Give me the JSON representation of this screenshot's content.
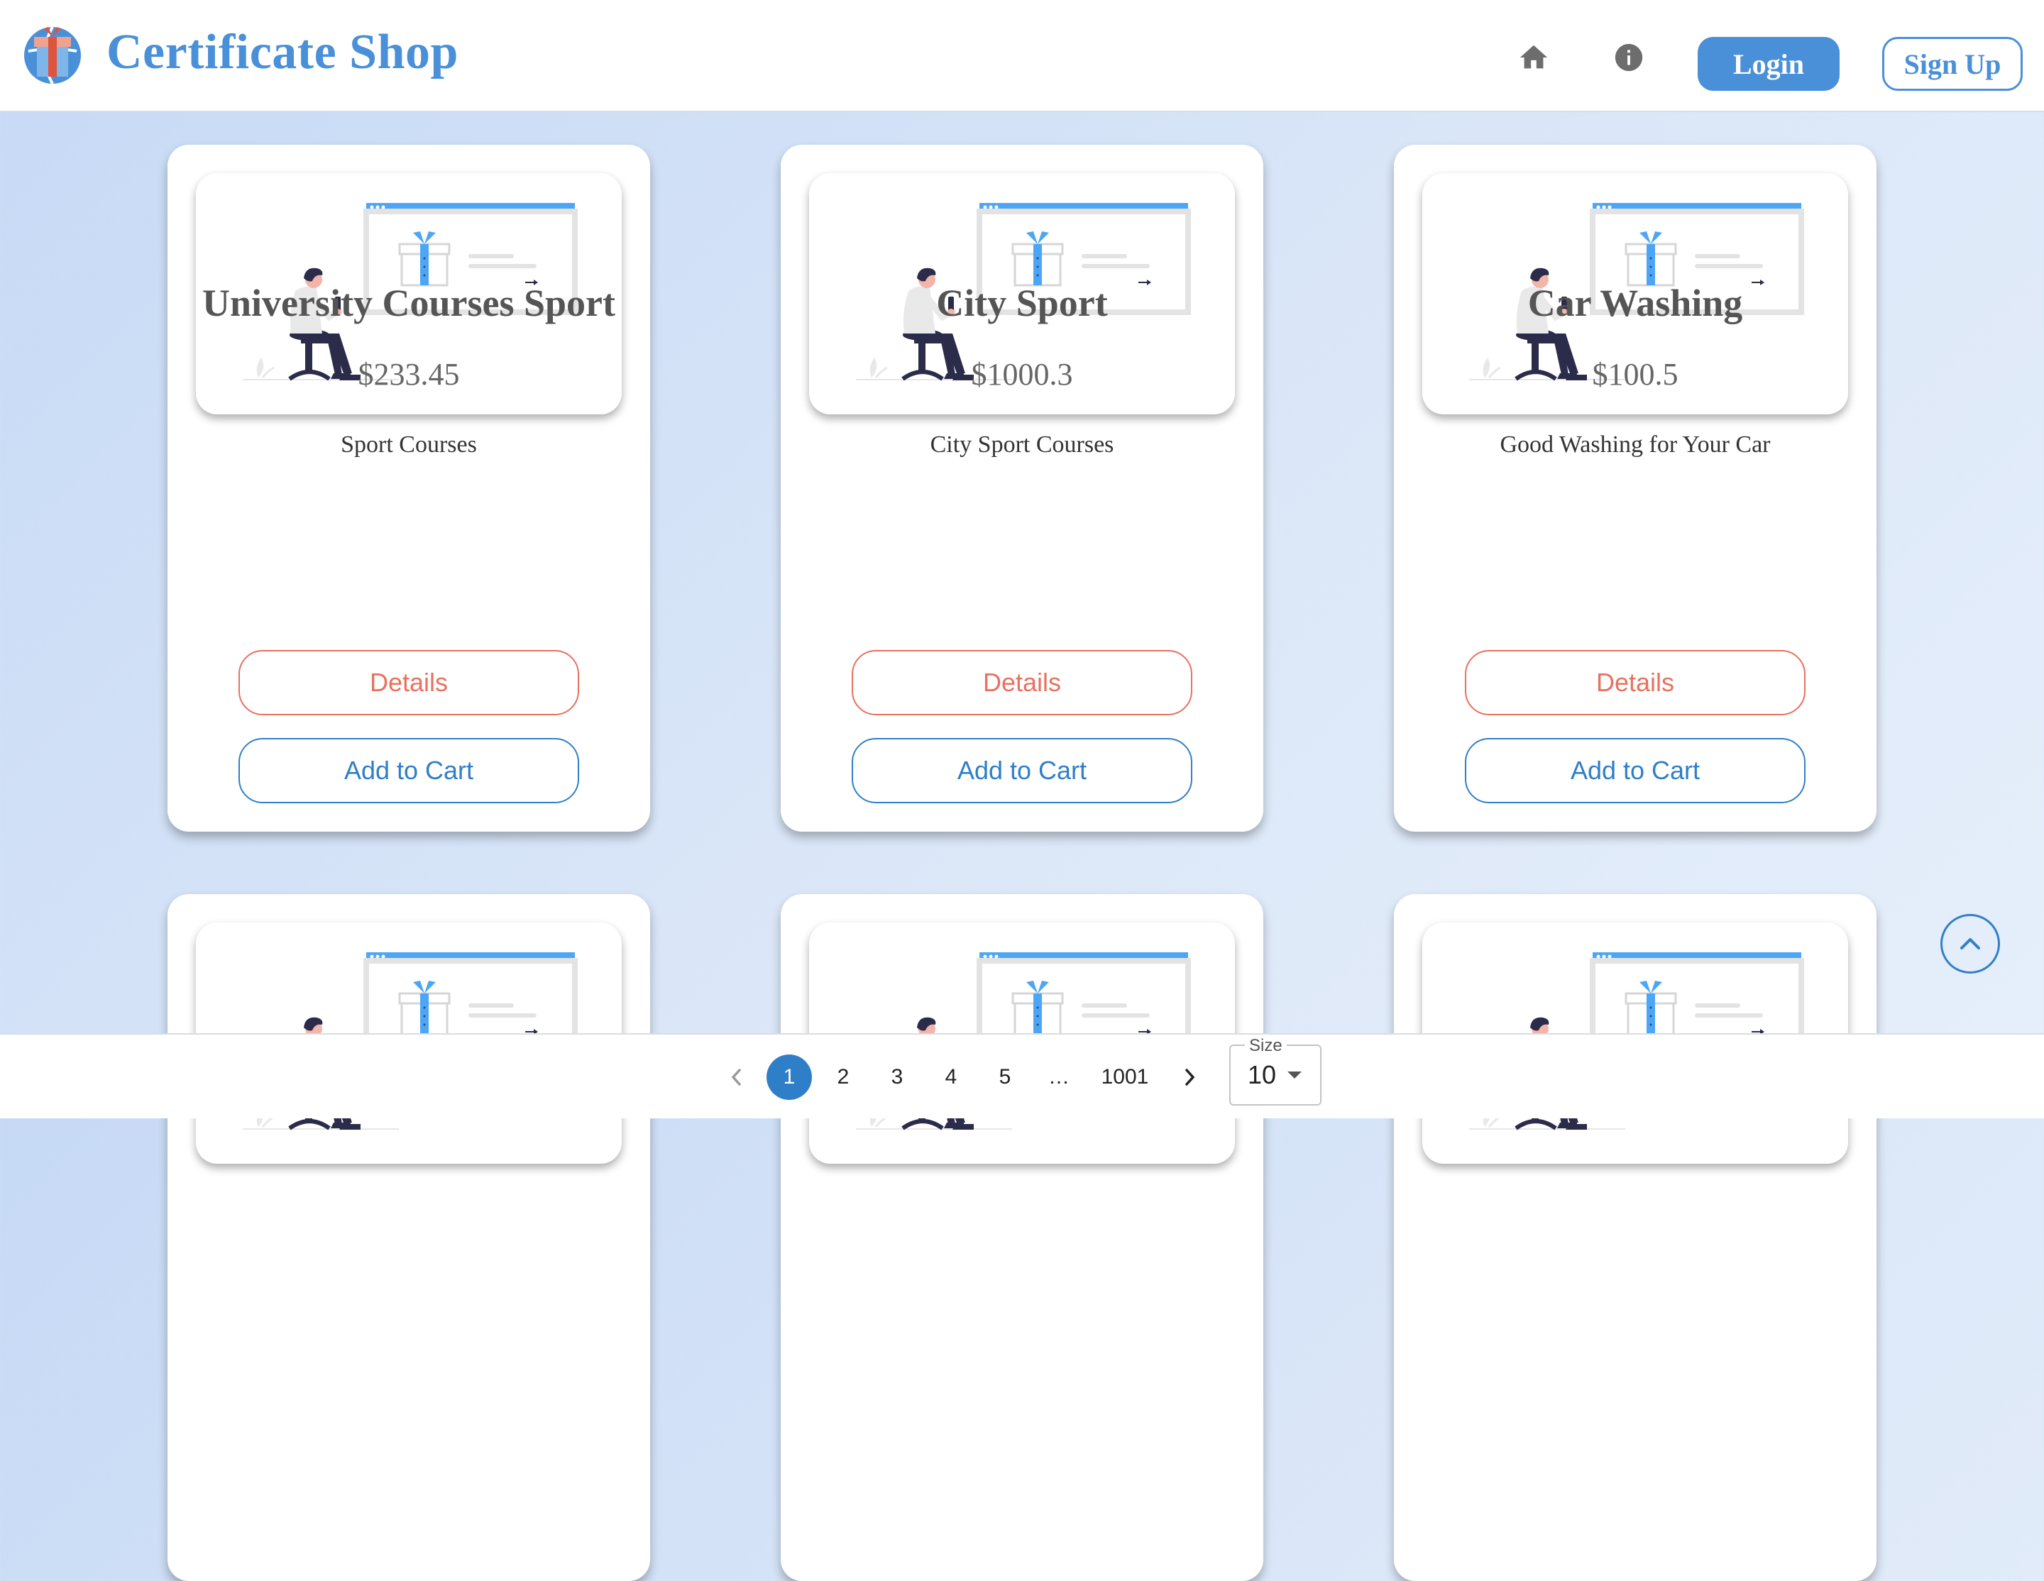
{
  "header": {
    "brand": "Certificate Shop",
    "nav": {
      "home_icon": "home-icon",
      "info_icon": "info-icon"
    },
    "login_label": "Login",
    "signup_label": "Sign Up"
  },
  "cards": [
    {
      "title": "University Courses Sport",
      "price": "$233.45",
      "description": "Sport Courses",
      "details_label": "Details",
      "cart_label": "Add to Cart"
    },
    {
      "title": "City Sport",
      "price": "$1000.3",
      "description": "City Sport Courses",
      "details_label": "Details",
      "cart_label": "Add to Cart"
    },
    {
      "title": "Car Washing",
      "price": "$100.5",
      "description": "Good Washing for Your Car",
      "details_label": "Details",
      "cart_label": "Add to Cart"
    }
  ],
  "pagination": {
    "pages": [
      "1",
      "2",
      "3",
      "4",
      "5",
      "…",
      "1001"
    ],
    "active_page": "1",
    "size_label": "Size",
    "size_value": "10"
  },
  "colors": {
    "brand": "#4a90d9",
    "details": "#e8715f",
    "cart": "#2f7fc8",
    "active_page": "#2f7fc8"
  }
}
